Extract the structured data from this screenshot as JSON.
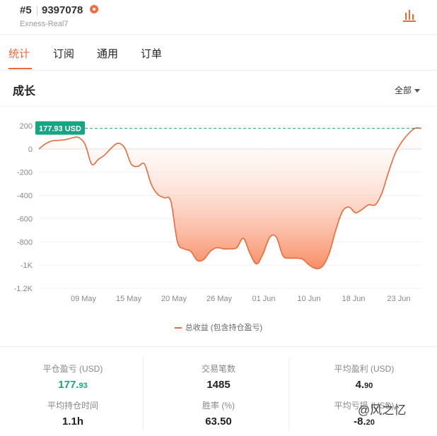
{
  "header": {
    "rank": "#5",
    "account_id": "9397078",
    "server": "Exness-Real7",
    "fire_icon": "fire-icon",
    "chart_icon": "bar-chart-icon"
  },
  "tabs": [
    {
      "label": "统计",
      "active": true
    },
    {
      "label": "订阅",
      "active": false
    },
    {
      "label": "通用",
      "active": false
    },
    {
      "label": "订单",
      "active": false
    }
  ],
  "section": {
    "title": "成长",
    "range": "全部"
  },
  "chart_data": {
    "type": "area",
    "ylabel_ticks": [
      "200",
      "0",
      "-200",
      "-400",
      "-600",
      "-800",
      "-1K",
      "-1.2K"
    ],
    "x_ticks": [
      "09 May",
      "15 May",
      "20 May",
      "26 May",
      "01 Jun",
      "10 Jun",
      "18 Jun",
      "23 Jun"
    ],
    "ylim": [
      -1200,
      200
    ],
    "current_value_label": "177.93 USD",
    "current_value": 177.93,
    "legend": "总收益 (包含持仓盈亏)",
    "colors": {
      "line": "#ea6a3a",
      "badge": "#15a583",
      "fill_top": "#ffffff",
      "fill_bottom": "#f98c64"
    },
    "series": [
      {
        "name": "总收益 (包含持仓盈亏)",
        "values": [
          0,
          45,
          70,
          75,
          80,
          95,
          100,
          40,
          -130,
          -90,
          -50,
          10,
          50,
          10,
          -130,
          -150,
          -130,
          -300,
          -390,
          -420,
          -450,
          -800,
          -860,
          -880,
          -960,
          -950,
          -880,
          -850,
          -860,
          -860,
          -850,
          -770,
          -900,
          -990,
          -900,
          -760,
          -760,
          -920,
          -940,
          -940,
          -950,
          -1000,
          -1030,
          -1010,
          -900,
          -700,
          -540,
          -500,
          -550,
          -520,
          -480,
          -480,
          -380,
          -200,
          -40,
          60,
          130,
          177.93,
          177.93
        ]
      }
    ]
  },
  "stats": [
    {
      "label": "平仓盈亏 (USD)",
      "int": "177.",
      "dec": "93",
      "green": true
    },
    {
      "label": "交易笔数",
      "int": "1485",
      "dec": "",
      "green": false
    },
    {
      "label": "平均盈利 (USD)",
      "int": "4.",
      "dec": "90",
      "green": false
    },
    {
      "label": "平均持仓时间",
      "int": "1.1h",
      "dec": "",
      "green": false
    },
    {
      "label": "胜率 (%)",
      "int": "63.50",
      "dec": "",
      "green": false
    },
    {
      "label": "平均亏损 (USD)",
      "int": "-8.",
      "dec": "20",
      "green": false
    }
  ],
  "watermark": "@风之忆"
}
